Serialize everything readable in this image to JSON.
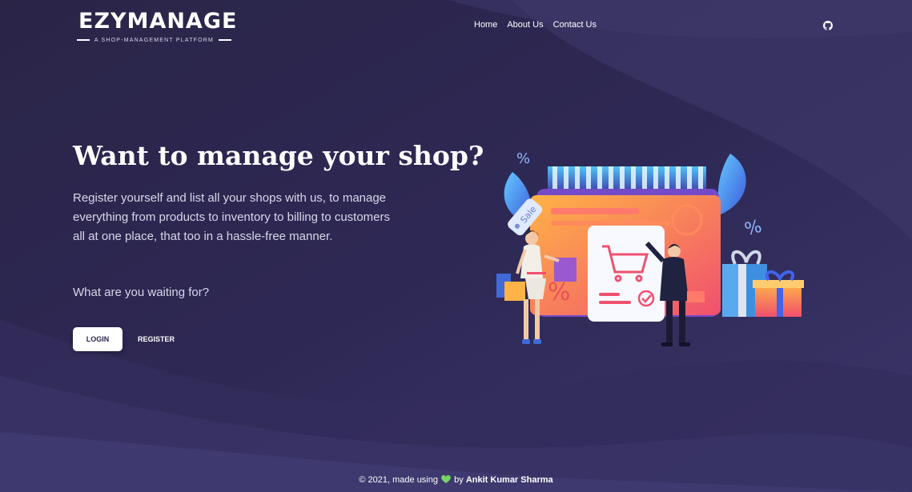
{
  "brand": {
    "name": "EZYMANAGE",
    "tagline": "A SHOP-MANAGEMENT PLATFORM"
  },
  "nav": {
    "items": [
      "Home",
      "About Us",
      "Contact Us"
    ],
    "github_icon": "github-icon"
  },
  "hero": {
    "title": "Want to manage your shop?",
    "description": "Register yourself and list all your shops with us, to manage everything from products to inventory to billing to customers all at one place, that too in a hassle-free manner.",
    "cta_text": "What are you waiting for?",
    "login_label": "LOGIN",
    "register_label": "REGISTER"
  },
  "illustration": {
    "sale_tag": "Sale",
    "percent_symbol": "%"
  },
  "footer": {
    "prefix": "© 2021, made using",
    "by": "by",
    "author": "Ankit Kumar Sharma"
  },
  "colors": {
    "background": "#2b2650",
    "accent_pink": "#f0506e",
    "accent_blue": "#3fa7e6",
    "accent_orange": "#ffb347"
  }
}
